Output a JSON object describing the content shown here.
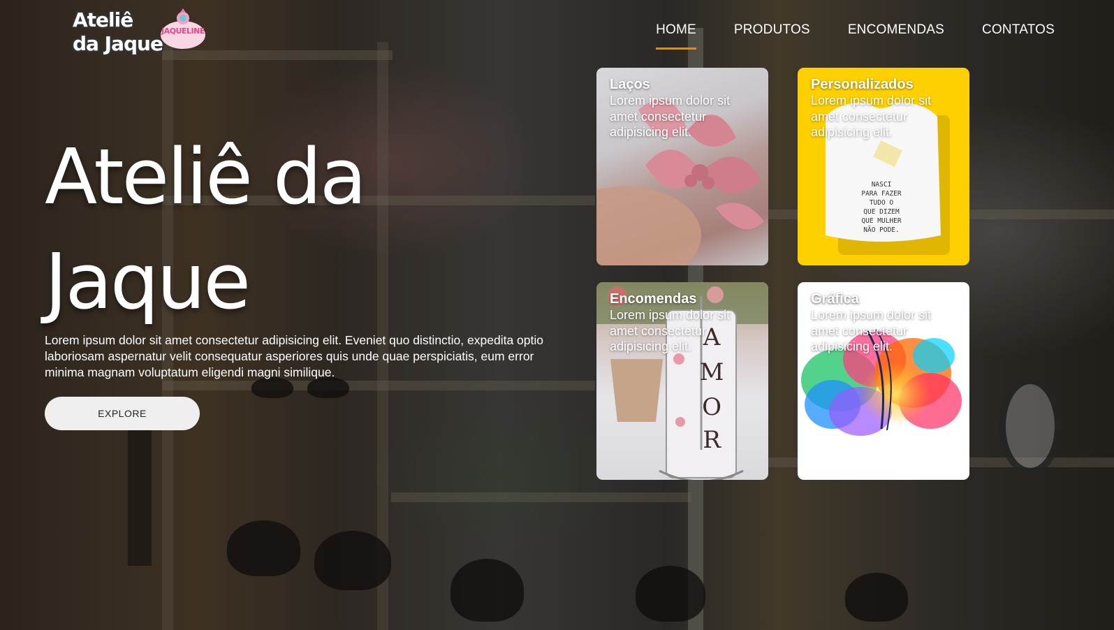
{
  "brand": {
    "logo_text": "Ateliê\nda Jaque",
    "badge_text": "JAQUELINE"
  },
  "nav": {
    "items": [
      {
        "label": "HOME",
        "active": true
      },
      {
        "label": "PRODUTOS",
        "active": false
      },
      {
        "label": "ENCOMENDAS",
        "active": false
      },
      {
        "label": "CONTATOS",
        "active": false
      }
    ],
    "accent_color": "#d9901b"
  },
  "hero": {
    "title": "Ateliê da Jaque",
    "description": "Lorem ipsum dolor sit amet consectetur adipisicing elit. Eveniet quo distinctio, expedita optio laboriosam aspernatur velit consequatur asperiores quis unde quae perspiciatis, eum error minima magnam voluptatum eligendi magni similique.",
    "button_label": "EXPLORE"
  },
  "cards": [
    {
      "title": "Laços",
      "description": "Lorem ipsum dolor sit amet consectetur adipisicing elit.",
      "image": "pink-bows-photo"
    },
    {
      "title": "Personalizados",
      "description": "Lorem ipsum dolor sit amet consectetur adipisicing elit.",
      "image": "printed-tshirt-photo",
      "shirt_text": "NASCI\nPARA FAZER\nTUDO O\nQUE DIZEM\nQUE MULHER\nNÃO PODE.",
      "background": "#ffd000"
    },
    {
      "title": "Encomendas",
      "description": "Lorem ipsum dolor sit amet consectetur adipisicing elit.",
      "image": "amor-mugs-photo",
      "mug_text": "AMOR"
    },
    {
      "title": "Gráfica",
      "description": "Lorem ipsum dolor sit amet consectetur adipisicing elit.",
      "image": "rainbow-splash-art",
      "background": "#ffffff"
    }
  ]
}
